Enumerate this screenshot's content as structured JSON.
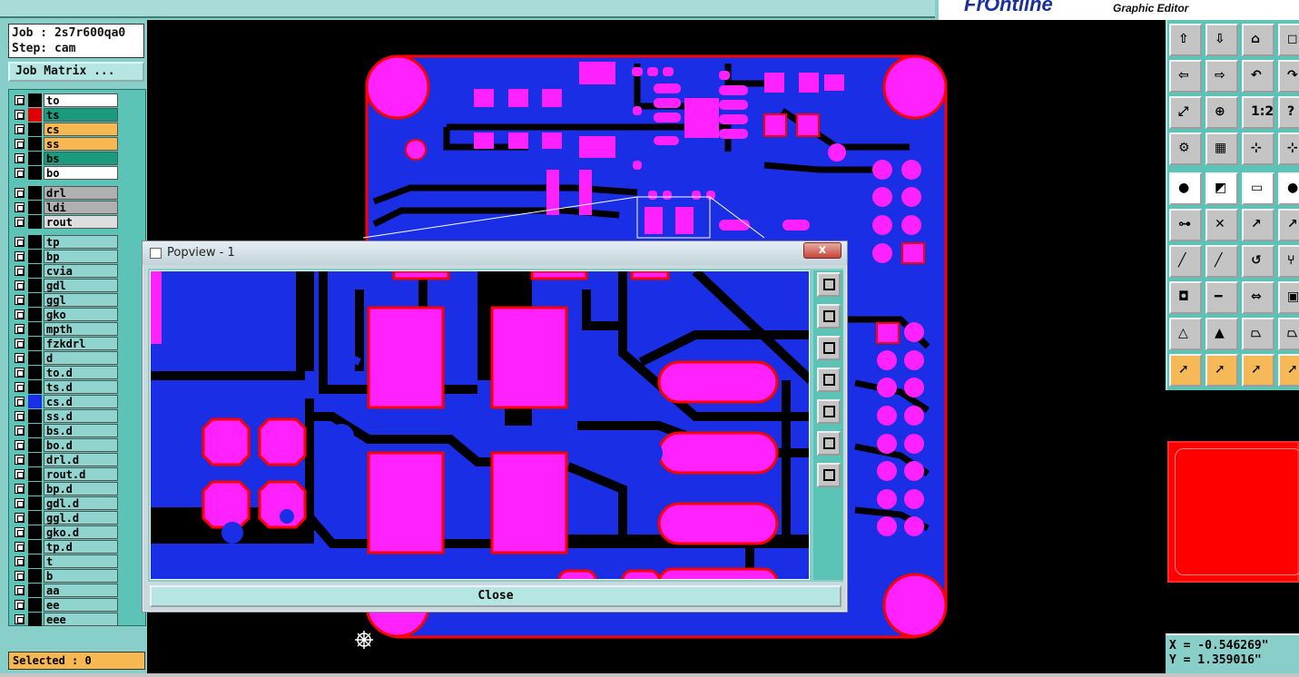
{
  "app": {
    "brand": "FrOntline",
    "subtitle": "Graphic Editor"
  },
  "left_panel": {
    "job_line": "Job : 2s7r600qa0",
    "step_line": "Step: cam",
    "job_matrix_label": "Job Matrix ...",
    "selected_label": "Selected : 0",
    "layers": [
      {
        "name": "to",
        "swatch": "#000000",
        "bg": "#ffffff",
        "mark": ""
      },
      {
        "name": "ts",
        "swatch": "#e00000",
        "bg": "#1a9b7e",
        "mark": ""
      },
      {
        "name": "cs",
        "swatch": "#000000",
        "bg": "#f7b852",
        "mark": "🖊"
      },
      {
        "name": "ss",
        "swatch": "#000000",
        "bg": "#f7b852",
        "mark": "🖊"
      },
      {
        "name": "bs",
        "swatch": "#000000",
        "bg": "#1a9b7e",
        "mark": ""
      },
      {
        "name": "bo",
        "swatch": "#000000",
        "bg": "#ffffff",
        "mark": "🖊"
      },
      {
        "name": "drl",
        "swatch": "#000000",
        "bg": "#b0b0b0",
        "mark": ""
      },
      {
        "name": "ldi",
        "swatch": "#000000",
        "bg": "#b0b0b0",
        "mark": ""
      },
      {
        "name": "rout",
        "swatch": "#000000",
        "bg": "#dedede",
        "mark": ""
      },
      {
        "name": "tp",
        "swatch": "#000000",
        "bg": "#8fd4ce",
        "mark": ""
      },
      {
        "name": "bp",
        "swatch": "#000000",
        "bg": "#8fd4ce",
        "mark": ""
      },
      {
        "name": "cvia",
        "swatch": "#000000",
        "bg": "#8fd4ce",
        "mark": ""
      },
      {
        "name": "gdl",
        "swatch": "#000000",
        "bg": "#8fd4ce",
        "mark": "🖊"
      },
      {
        "name": "ggl",
        "swatch": "#000000",
        "bg": "#8fd4ce",
        "mark": ""
      },
      {
        "name": "gko",
        "swatch": "#000000",
        "bg": "#8fd4ce",
        "mark": ""
      },
      {
        "name": "mpth",
        "swatch": "#000000",
        "bg": "#8fd4ce",
        "mark": ""
      },
      {
        "name": "fzkdrl",
        "swatch": "#000000",
        "bg": "#8fd4ce",
        "mark": ""
      },
      {
        "name": "d",
        "swatch": "#000000",
        "bg": "#8fd4ce",
        "mark": ""
      },
      {
        "name": "to.d",
        "swatch": "#000000",
        "bg": "#8fd4ce",
        "mark": ""
      },
      {
        "name": "ts.d",
        "swatch": "#000000",
        "bg": "#8fd4ce",
        "mark": ""
      },
      {
        "name": "cs.d",
        "swatch": "#1a2ee6",
        "bg": "#8fd4ce",
        "mark": "🖊▦"
      },
      {
        "name": "ss.d",
        "swatch": "#000000",
        "bg": "#8fd4ce",
        "mark": "🖊"
      },
      {
        "name": "bs.d",
        "swatch": "#000000",
        "bg": "#8fd4ce",
        "mark": ""
      },
      {
        "name": "bo.d",
        "swatch": "#000000",
        "bg": "#8fd4ce",
        "mark": "🖊"
      },
      {
        "name": "drl.d",
        "swatch": "#000000",
        "bg": "#8fd4ce",
        "mark": ""
      },
      {
        "name": "rout.d",
        "swatch": "#000000",
        "bg": "#8fd4ce",
        "mark": ""
      },
      {
        "name": "bp.d",
        "swatch": "#000000",
        "bg": "#8fd4ce",
        "mark": ""
      },
      {
        "name": "gdl.d",
        "swatch": "#000000",
        "bg": "#8fd4ce",
        "mark": "🖊"
      },
      {
        "name": "ggl.d",
        "swatch": "#000000",
        "bg": "#8fd4ce",
        "mark": ""
      },
      {
        "name": "gko.d",
        "swatch": "#000000",
        "bg": "#8fd4ce",
        "mark": ""
      },
      {
        "name": "tp.d",
        "swatch": "#000000",
        "bg": "#8fd4ce",
        "mark": ""
      },
      {
        "name": "t",
        "swatch": "#000000",
        "bg": "#8fd4ce",
        "mark": ""
      },
      {
        "name": "b",
        "swatch": "#000000",
        "bg": "#8fd4ce",
        "mark": ""
      },
      {
        "name": "aa",
        "swatch": "#000000",
        "bg": "#8fd4ce",
        "mark": ""
      },
      {
        "name": "ee",
        "swatch": "#000000",
        "bg": "#8fd4ce",
        "mark": ""
      },
      {
        "name": "eee",
        "swatch": "#000000",
        "bg": "#8fd4ce",
        "mark": ""
      }
    ]
  },
  "popview": {
    "title": "Popview - 1",
    "close_x": "x",
    "close_label": "Close",
    "tool_icons": [
      "zoom-window-icon",
      "pan-up-icon",
      "pan-down-icon",
      "pan-left-icon",
      "pan-right-icon",
      "zoom-fit-icon",
      "zoom-home-icon"
    ]
  },
  "right_toolbar": {
    "rows": [
      [
        "pan-up-icon",
        "pan-down-icon",
        "home-icon",
        "zoom-icon"
      ],
      [
        "pan-left-icon",
        "pan-right-icon",
        "undo-view-icon",
        "redo-view-icon"
      ],
      [
        "zoom-fit-icon",
        "zoom-center-icon",
        "scale-1-2-icon",
        "help-icon"
      ],
      [
        "measure-tool-icon",
        "grid-icon",
        "snap-icon",
        "snap-alt-icon"
      ],
      [
        "select-point-icon",
        "select-feature-icon",
        "ruler-icon",
        "filled-circle-icon"
      ],
      [
        "connect-icon",
        "cross-icon",
        "move-icon",
        "copy-icon"
      ],
      [
        "line-icon",
        "slash-icon",
        "arc-icon",
        "fork-icon"
      ],
      [
        "pad-icon",
        "minus-icon",
        "resize-icon",
        "group-icon"
      ],
      [
        "triangle-icon",
        "up-triangle-icon",
        "trapezoid-icon",
        "trapezoid-alt-icon"
      ],
      [
        "pointer-icon",
        "pointer-box-icon",
        "pointer-diamond-icon",
        "pointer-bracket-icon"
      ]
    ],
    "scale_label": "1:2"
  },
  "coords": {
    "x": "X = -0.546269\"",
    "y": "Y = 1.359016\""
  },
  "colors": {
    "copper": "#1a2ee6",
    "pad": "#ff22ff",
    "outline": "#ff0000",
    "panel": "#88cfc9"
  }
}
